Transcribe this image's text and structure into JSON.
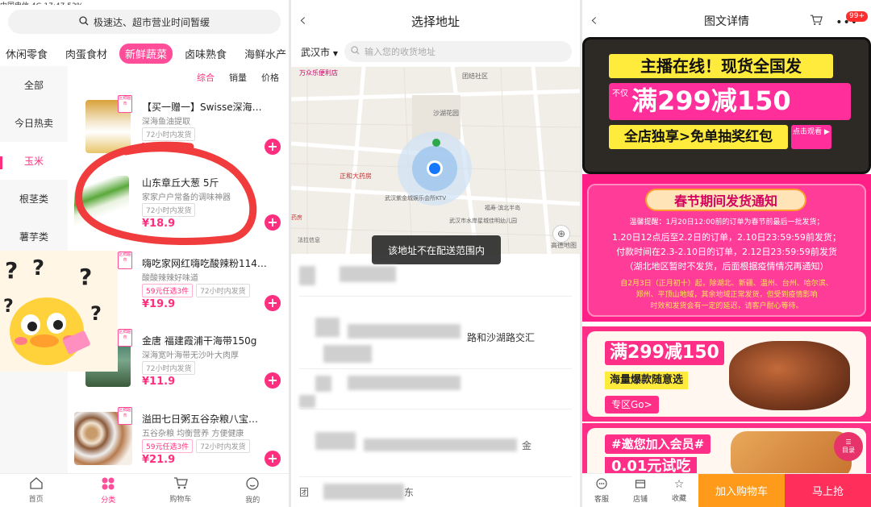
{
  "panel1": {
    "status_text": "中国电信 4G   17:47   53%",
    "search_text": "极速达、超市营业时间暂缓",
    "categories": [
      "休闲零食",
      "肉蛋食材",
      "新鲜蔬菜",
      "卤味熟食",
      "海鲜水产"
    ],
    "side_items": [
      "全部",
      "今日热卖",
      "玉米",
      "根茎类",
      "薯芋类"
    ],
    "sort": [
      "综合",
      "销量",
      "价格"
    ],
    "products": [
      {
        "title": "【买一赠一】Swisse深海…",
        "desc": "深海鱼油提取",
        "chips": [
          "72小时内发货"
        ],
        "price": "¥189.9"
      },
      {
        "title": "山东章丘大葱 5斤",
        "desc": "家家户户常备的调味神器",
        "chips": [
          "72小时内发货"
        ],
        "price": "¥18.9"
      },
      {
        "title": "嗨吃家网红嗨吃酸辣粉114…",
        "desc": "酸酸辣辣好味道",
        "chips": [
          "59元任选3件",
          "72小时内发货"
        ],
        "price": "¥19.9"
      },
      {
        "title": "金唐 福建霞浦干海带150g",
        "desc": "深海宽叶海带无沙叶大肉厚",
        "chips": [
          "72小时内发货"
        ],
        "price": "¥11.9"
      },
      {
        "title": "溢田七日粥五谷杂粮八宝…",
        "desc": "五谷杂粮 均衡营养 方便健康",
        "chips": [
          "59元任选3件",
          "72小时内发货"
        ],
        "price": "¥21.9"
      }
    ],
    "tag_text": "区鲜超市",
    "tabs": [
      "首页",
      "分类",
      "购物车",
      "我的"
    ]
  },
  "panel2": {
    "title": "选择地址",
    "city": "武汉市",
    "placeholder": "输入您的收货地址",
    "toast": "该地址不在配送范围内",
    "map_labels": [
      "万众乐便利店",
      "团结社区",
      "沙湖花园",
      "正和大药房",
      "武汉紫金城娱乐会所KTV",
      "福寿·滨北半岛",
      "武汉市水岸星城佳明幼儿园",
      "法拉信息",
      "药房",
      "高德地图"
    ],
    "addresses": [
      "",
      "路和沙湖路交汇",
      "",
      "",
      "金",
      "东"
    ]
  },
  "panel3": {
    "title": "图文详情",
    "badge": "99+",
    "banner1": {
      "line1": "主播在线！现货全国发",
      "line2a": "不仅",
      "line2b": "满299减150",
      "line3": "全店独享>免单抽奖红包",
      "cta": "点击观看"
    },
    "notice": {
      "title": "春节期间发货通知",
      "lines": [
        "温馨提醒：1月20日12:00前的订单为春节前最后一批发货；",
        "1.20日12点后至2.2日的订单，2.10日23:59:59前发货；",
        "付款时间在2.3-2.10日的订单，2.12日23:59:59前发货",
        "（湖北地区暂时不发货，后面根据疫情情况再通知）",
        "自2月3日（正月初十）起，除湖北、新疆、温州、台州、哈尔滨、",
        "郑州、平顶山地域，其余地域正常发货，但受到疫情影响",
        "时效和发货会有一定的延迟，请客户耐心等待。"
      ]
    },
    "promo": {
      "title": "满299减150",
      "sub": "海量爆款随意选",
      "btn": "专区Go>"
    },
    "member": {
      "title": "#邀您加入会员#",
      "sub": "0.01元试吃"
    },
    "fab": "目录",
    "bottom": {
      "icons": [
        "客服",
        "店铺",
        "收藏"
      ],
      "add_cart": "加入购物车",
      "buy": "马上抢"
    }
  }
}
